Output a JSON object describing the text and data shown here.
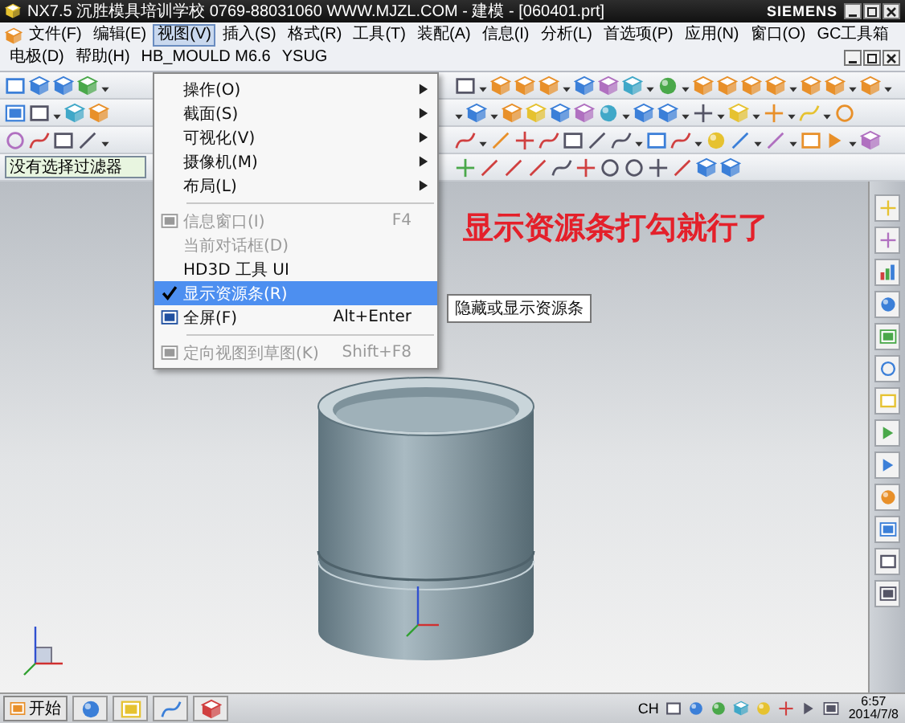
{
  "window": {
    "title": "NX7.5  沉胜模具培训学校  0769-88031060  WWW.MJZL.COM - 建模 - [060401.prt]",
    "brand": "SIEMENS"
  },
  "menu_bar": [
    {
      "label": "文件(F)",
      "selected": false
    },
    {
      "label": "编辑(E)",
      "selected": false
    },
    {
      "label": "视图(V)",
      "selected": true
    },
    {
      "label": "插入(S)",
      "selected": false
    },
    {
      "label": "格式(R)",
      "selected": false
    },
    {
      "label": "工具(T)",
      "selected": false
    },
    {
      "label": "装配(A)",
      "selected": false
    },
    {
      "label": "信息(I)",
      "selected": false
    },
    {
      "label": "分析(L)",
      "selected": false
    },
    {
      "label": "首选项(P)",
      "selected": false
    },
    {
      "label": "应用(N)",
      "selected": false
    },
    {
      "label": "窗口(O)",
      "selected": false
    },
    {
      "label": "GC工具箱",
      "selected": false
    },
    {
      "label": "电极(D)",
      "selected": false
    },
    {
      "label": "帮助(H)",
      "selected": false
    },
    {
      "label": "HB_MOULD M6.6",
      "selected": false
    },
    {
      "label": "YSUG",
      "selected": false
    }
  ],
  "filter_field": {
    "value": "没有选择过滤器"
  },
  "view_menu": {
    "items": [
      {
        "kind": "submenu",
        "label": "操作(O)",
        "disabled": false,
        "checked": false,
        "selected": false,
        "icon": false
      },
      {
        "kind": "submenu",
        "label": "截面(S)",
        "disabled": false,
        "checked": false,
        "selected": false,
        "icon": false
      },
      {
        "kind": "submenu",
        "label": "可视化(V)",
        "disabled": false,
        "checked": false,
        "selected": false,
        "icon": false
      },
      {
        "kind": "submenu",
        "label": "摄像机(M)",
        "disabled": false,
        "checked": false,
        "selected": false,
        "icon": false
      },
      {
        "kind": "submenu",
        "label": "布局(L)",
        "disabled": false,
        "checked": false,
        "selected": false,
        "icon": false
      },
      {
        "kind": "separator"
      },
      {
        "kind": "command",
        "label": "信息窗口(I)",
        "shortcut": "F4",
        "disabled": true,
        "checked": false,
        "selected": false,
        "icon": true
      },
      {
        "kind": "command",
        "label": "当前对话框(D)",
        "disabled": true,
        "checked": false,
        "selected": false,
        "icon": false
      },
      {
        "kind": "command",
        "label": "HD3D 工具 UI",
        "disabled": false,
        "checked": false,
        "selected": false,
        "icon": false
      },
      {
        "kind": "command",
        "label": "显示资源条(R)",
        "disabled": false,
        "checked": true,
        "selected": true,
        "icon": false,
        "tooltip": "隐藏或显示资源条"
      },
      {
        "kind": "command",
        "label": "全屏(F)",
        "shortcut": "Alt+Enter",
        "disabled": false,
        "checked": false,
        "selected": false,
        "icon": true
      },
      {
        "kind": "separator"
      },
      {
        "kind": "command",
        "label": "定向视图到草图(K)",
        "shortcut": "Shift+F8",
        "disabled": true,
        "checked": false,
        "selected": false,
        "icon": true
      }
    ]
  },
  "annotation": "显示资源条打勾就行了",
  "taskbar": {
    "start": "开始",
    "language": "CH",
    "time": "6:57",
    "date": "2014/7/8"
  }
}
